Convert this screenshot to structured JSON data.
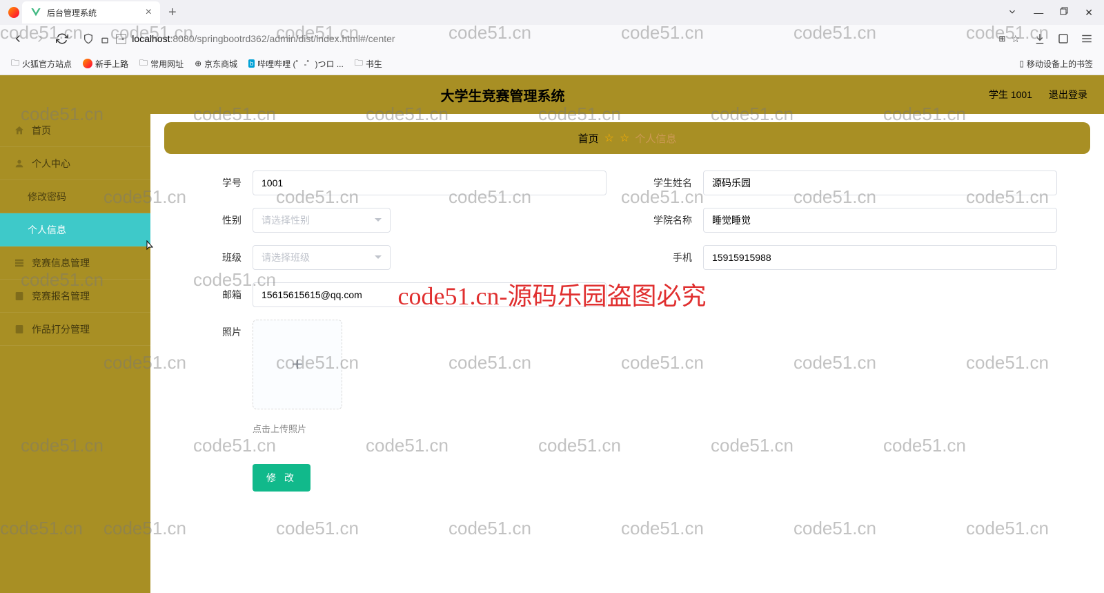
{
  "browser": {
    "tab_title": "后台管理系统",
    "url_host": "localhost",
    "url_port": ":8080",
    "url_path": "/springbootrd362/admin/dist/index.html#/center",
    "bookmarks": [
      "火狐官方站点",
      "新手上路",
      "常用网址",
      "京东商城",
      "哔哩哔哩 (゜-゜)つロ ...",
      "书生"
    ],
    "bookmark_right": "移动设备上的书签"
  },
  "header": {
    "title": "大学生竞赛管理系统",
    "user": "学生 1001",
    "logout": "退出登录"
  },
  "sidebar": {
    "items": [
      {
        "label": "首页"
      },
      {
        "label": "个人中心"
      },
      {
        "label": "修改密码"
      },
      {
        "label": "个人信息"
      },
      {
        "label": "竞赛信息管理"
      },
      {
        "label": "竞赛报名管理"
      },
      {
        "label": "作品打分管理"
      }
    ]
  },
  "breadcrumb": {
    "home": "首页",
    "current": "个人信息"
  },
  "form": {
    "student_id": {
      "label": "学号",
      "value": "1001"
    },
    "student_name": {
      "label": "学生姓名",
      "value": "源码乐园"
    },
    "gender": {
      "label": "性别",
      "placeholder": "请选择性别"
    },
    "college": {
      "label": "学院名称",
      "value": "睡觉睡觉"
    },
    "class": {
      "label": "班级",
      "placeholder": "请选择班级"
    },
    "phone": {
      "label": "手机",
      "value": "15915915988"
    },
    "email": {
      "label": "邮箱",
      "value": "15615615615@qq.com"
    },
    "photo": {
      "label": "照片",
      "hint": "点击上传照片"
    },
    "submit": "修 改"
  },
  "watermark": {
    "text": "code51.cn",
    "red_text": "code51.cn-源码乐园盗图必究"
  }
}
